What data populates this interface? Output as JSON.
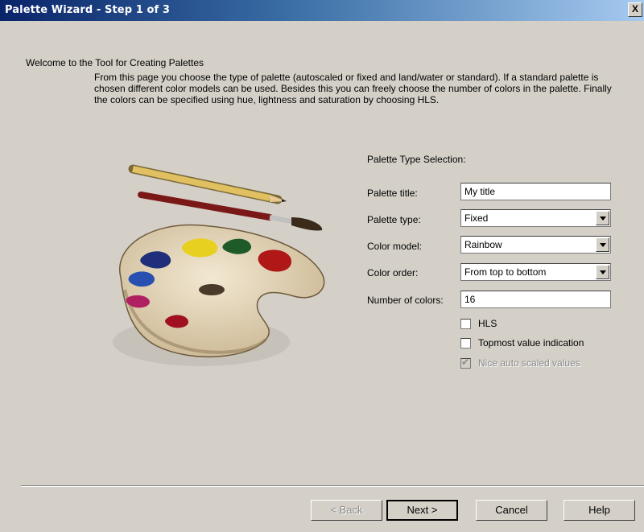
{
  "window": {
    "title": "Palette Wizard - Step 1 of 3",
    "close_label": "X"
  },
  "intro": {
    "welcome": "Welcome to the Tool for Creating Palettes",
    "description": "From this page you choose the type of palette (autoscaled or fixed and land/water or standard). If a standard palette is chosen different color models can be used. Besides this you can freely choose the number of colors in the palette. Finally the colors can be specified using hue, lightness and saturation by choosing HLS."
  },
  "form": {
    "section_title": "Palette Type Selection:",
    "palette_title": {
      "label": "Palette title:",
      "value": "My title"
    },
    "palette_type": {
      "label": "Palette type:",
      "value": "Fixed"
    },
    "color_model": {
      "label": "Color model:",
      "value": "Rainbow"
    },
    "color_order": {
      "label": "Color order:",
      "value": "From top to bottom"
    },
    "number_of_colors": {
      "label": "Number of colors:",
      "value": "16"
    },
    "hls": {
      "label": "HLS",
      "checked": false
    },
    "topmost": {
      "label": "Topmost value indication",
      "checked": false
    },
    "nice_auto": {
      "label": "Nice auto scaled values",
      "checked": true,
      "disabled": true
    }
  },
  "buttons": {
    "back": "< Back",
    "next": "Next >",
    "cancel": "Cancel",
    "help": "Help"
  },
  "colors": {
    "titlebar_start": "#0a246a",
    "titlebar_end": "#a6caf0",
    "dialog_bg": "#d4d0c8"
  }
}
